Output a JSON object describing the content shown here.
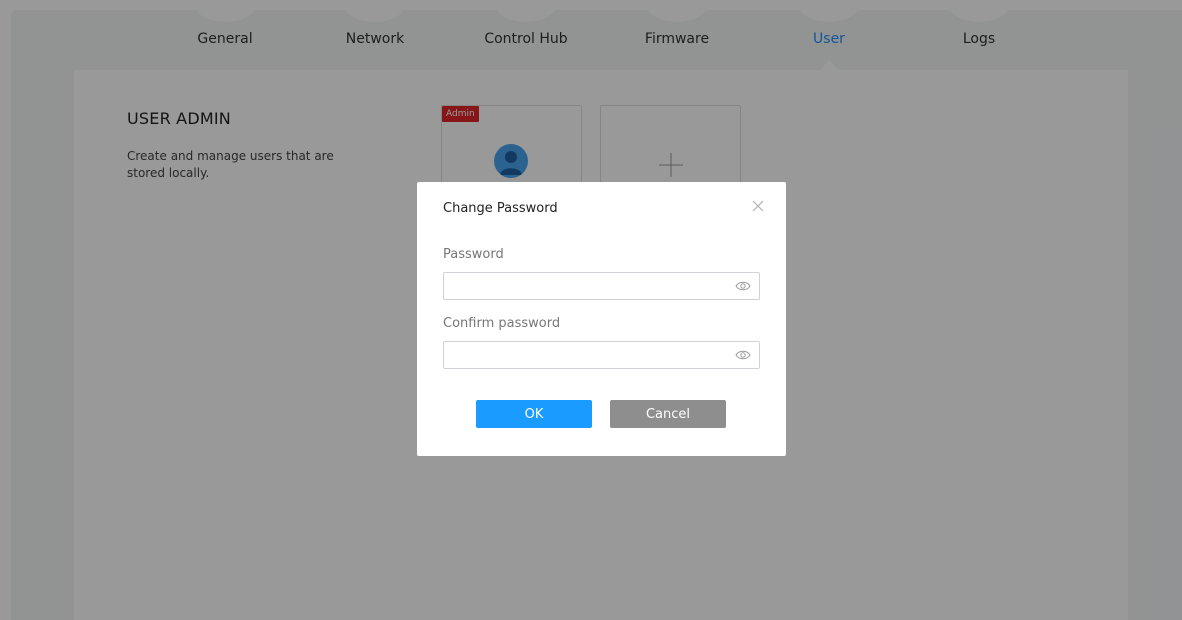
{
  "nav": {
    "tabs": [
      {
        "label": "General"
      },
      {
        "label": "Network"
      },
      {
        "label": "Control Hub"
      },
      {
        "label": "Firmware"
      },
      {
        "label": "User",
        "active": true
      },
      {
        "label": "Logs"
      }
    ]
  },
  "user_admin": {
    "title": "USER ADMIN",
    "description": "Create and manage users that are stored locally.",
    "users": [
      {
        "badge": "Admin",
        "avatar_icon": "user-avatar-icon"
      }
    ],
    "add_icon": "plus-icon"
  },
  "dialog": {
    "title": "Change Password",
    "close_icon": "close-icon",
    "password_label": "Password",
    "password_value": "",
    "confirm_label": "Confirm password",
    "confirm_value": "",
    "visibility_icon": "eye-icon",
    "ok_label": "OK",
    "cancel_label": "Cancel"
  },
  "colors": {
    "accent": "#1a9bff",
    "active_tab": "#1e90ff",
    "admin_badge": "#e2262a",
    "cancel_button": "#8e8e8e"
  }
}
